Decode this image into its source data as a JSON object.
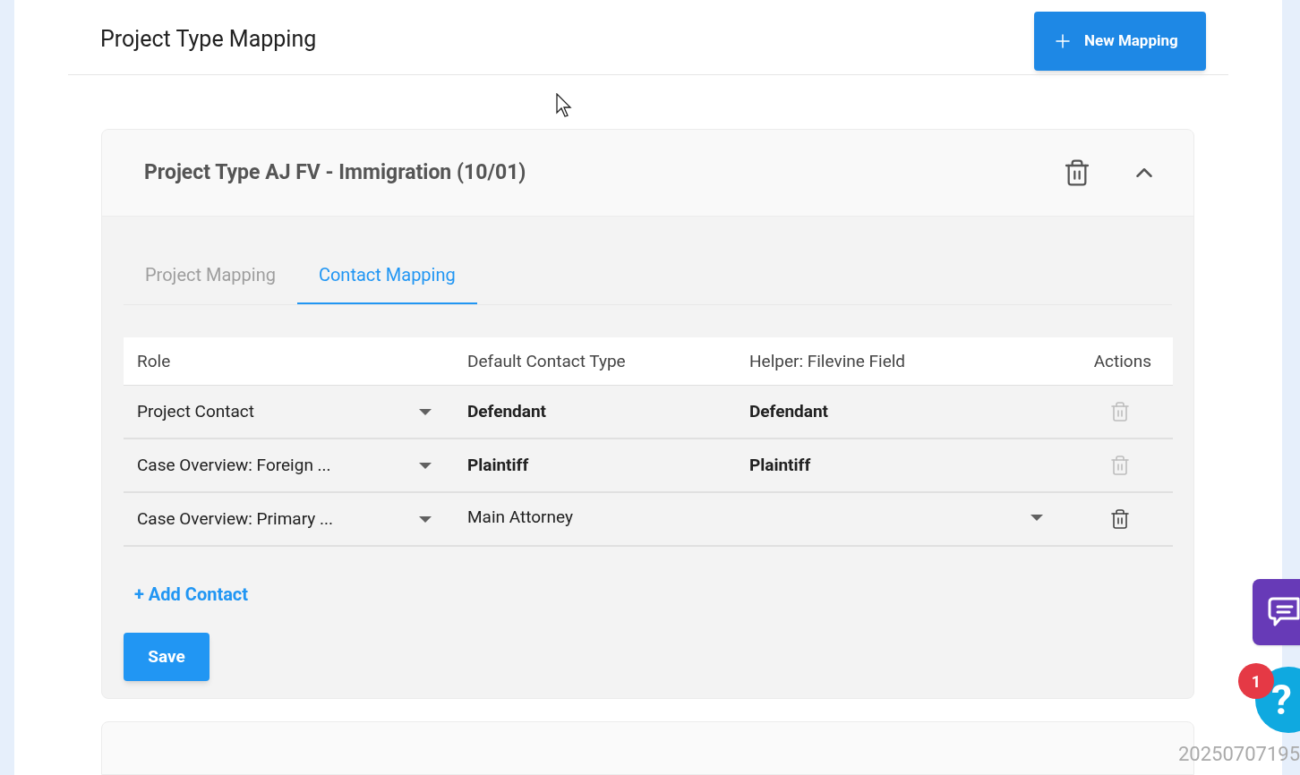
{
  "page": {
    "title": "Project Type Mapping",
    "new_button": "New Mapping"
  },
  "mapping": {
    "title": "Project Type AJ FV - Immigration (10/01)",
    "expanded": true,
    "tabs": [
      {
        "label": "Project Mapping",
        "selected": false
      },
      {
        "label": "Contact Mapping",
        "selected": true
      }
    ],
    "table": {
      "columns": [
        "Role",
        "Default Contact Type",
        "Helper: Filevine Field",
        "Actions"
      ],
      "rows": [
        {
          "kind": "fixed",
          "role": "Project Contact",
          "default_contact_type": "Defendant",
          "helper_field": "Defendant",
          "disabled": true
        },
        {
          "kind": "fixed",
          "role": "Case Overview: Foreign ...",
          "default_contact_type": "Plaintiff",
          "helper_field": "Plaintiff",
          "disabled": true
        },
        {
          "kind": "select",
          "role": "Case Overview: Primary ...",
          "default_contact_type": "Main Attorney",
          "disabled": false
        }
      ]
    },
    "add_link": "+ Add Contact",
    "save": "Save"
  },
  "help": {
    "badge": "1",
    "glyph": "?"
  },
  "timestamp": "20250707195"
}
